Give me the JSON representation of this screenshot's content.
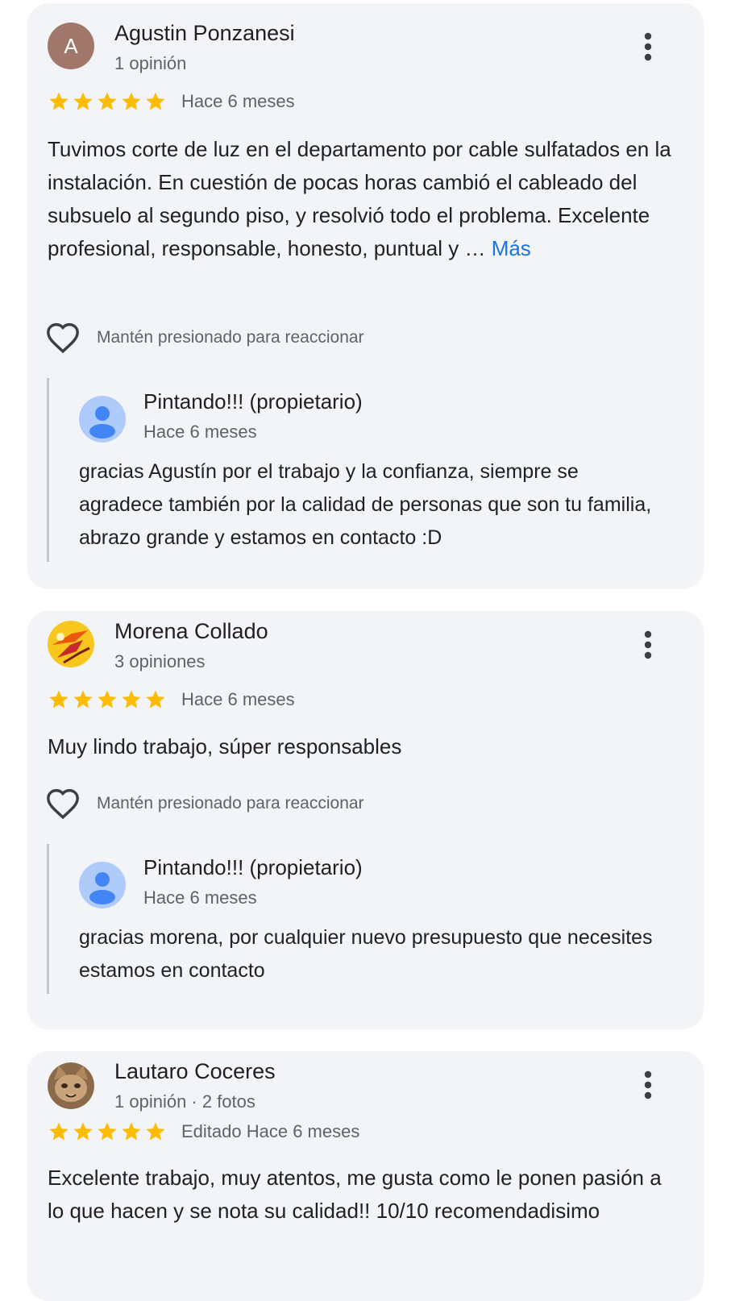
{
  "reviews": [
    {
      "author": "Agustin Ponzanesi",
      "avatar_letter": "A",
      "avatar_color": "#a0776a",
      "meta": "1 opinión",
      "rating": 5,
      "date": "Hace 6 meses",
      "text": "Tuvimos corte de luz en el departamento por cable sulfatados en la instalación. En cuestión de pocas horas cambió el cableado del subsuelo al segundo piso, y resolvió todo el problema. Excelente profesional, responsable, honesto, puntual y … ",
      "more_label": "Más",
      "react_label": "Mantén presionado para reaccionar",
      "reply": {
        "author": "Pintando!!! (propietario)",
        "date": "Hace 6 meses",
        "text": "gracias Agustín por el trabajo y la confianza, siempre se agradece también por la calidad de personas que son tu familia, abrazo grande y estamos en contacto :D"
      }
    },
    {
      "author": "Morena Collado",
      "meta": "3 opiniones",
      "rating": 5,
      "date": "Hace 6 meses",
      "text": "Muy lindo trabajo, súper responsables",
      "react_label": "Mantén presionado para reaccionar",
      "reply": {
        "author": "Pintando!!! (propietario)",
        "date": "Hace 6 meses",
        "text": "gracias morena, por cualquier nuevo presupuesto que necesites estamos en contacto"
      }
    },
    {
      "author": "Lautaro Coceres",
      "meta": "1 opinión · 2 fotos",
      "rating": 5,
      "date": "Editado Hace 6 meses",
      "text": "Excelente trabajo, muy atentos, me gusta como le ponen pasión a lo que hacen y se nota su calidad!! 10/10 recomendadisimo"
    }
  ],
  "colors": {
    "card_bg": "#f2f4f7",
    "star": "#fbbc04",
    "link": "#1a73e8",
    "muted_text": "#5f6368",
    "reply_avatar": "#aecbfa",
    "reply_avatar_figure": "#4285f4"
  },
  "icons": {
    "menu": "more-vert-icon",
    "star": "star-icon",
    "heart": "heart-outline-icon",
    "reply_avatar": "person-icon"
  }
}
